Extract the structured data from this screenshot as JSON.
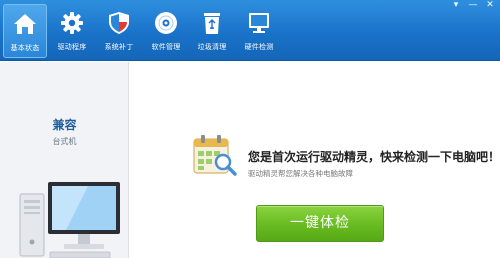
{
  "toolbar": {
    "items": [
      {
        "label": "基本状态",
        "icon": "home-icon",
        "active": true
      },
      {
        "label": "驱动程序",
        "icon": "gear-icon",
        "active": false
      },
      {
        "label": "系统补丁",
        "icon": "shield-icon",
        "active": false
      },
      {
        "label": "软件管理",
        "icon": "disc-icon",
        "active": false
      },
      {
        "label": "垃圾清理",
        "icon": "recycle-bin-icon",
        "active": false
      },
      {
        "label": "硬件检测",
        "icon": "monitor-icon",
        "active": false
      }
    ],
    "window_controls": {
      "menu": "▾",
      "minimize": "—",
      "close": "✕"
    }
  },
  "left_panel": {
    "title": "兼容",
    "subtitle": "台式机",
    "illustration": "desktop-computer-icon"
  },
  "main": {
    "icon": "calendar-search-icon",
    "headline": "您是首次运行驱动精灵，快来检测一下电脑吧！",
    "subline": "驱动精灵帮您解决各种电脑故障",
    "button_label": "一键体检"
  },
  "colors": {
    "toolbar_blue": "#1a73c9",
    "button_green": "#68bb21",
    "title_blue": "#1f5d9c"
  }
}
